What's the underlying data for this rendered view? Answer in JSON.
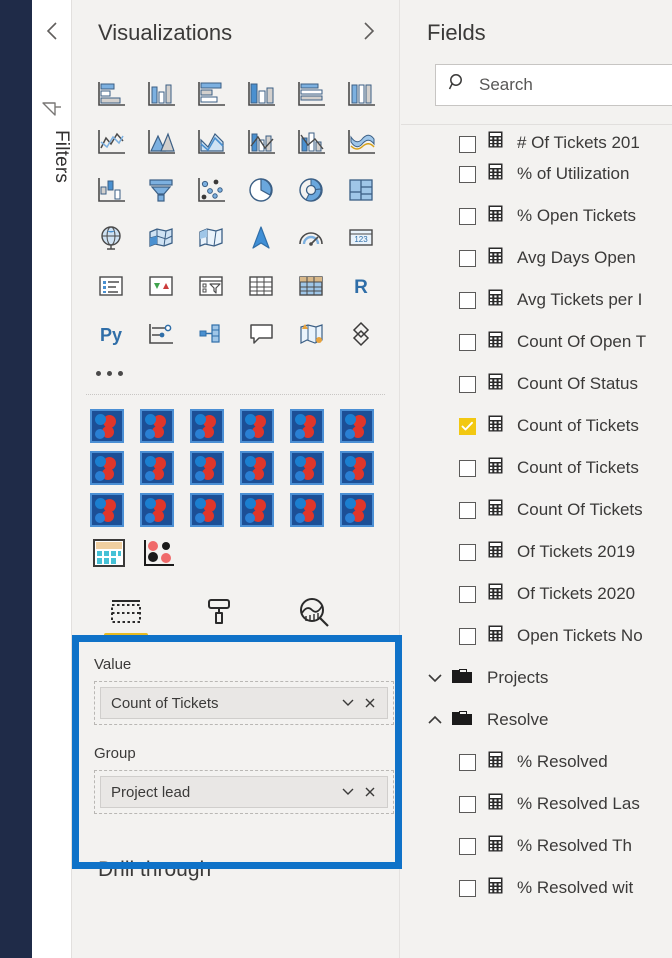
{
  "left_rail": {
    "name": "nav-rail"
  },
  "filters_pane": {
    "collapse_icon": "chevron-left-icon",
    "funnel_icon": "filter-funnel-icon",
    "label": "Filters"
  },
  "visualizations": {
    "title": "Visualizations",
    "expand_icon": "chevron-right-icon",
    "icons": [
      "stacked-bar-chart-icon",
      "stacked-column-chart-icon",
      "clustered-bar-chart-icon",
      "clustered-column-chart-icon",
      "hundred-percent-stacked-bar-chart-icon",
      "hundred-percent-stacked-column-chart-icon",
      "line-chart-icon",
      "area-chart-icon",
      "stacked-area-chart-icon",
      "line-and-stacked-column-chart-icon",
      "line-and-clustered-column-chart-icon",
      "ribbon-chart-icon",
      "waterfall-chart-icon",
      "funnel-chart-icon",
      "scatter-chart-icon",
      "pie-chart-icon",
      "donut-chart-icon",
      "treemap-icon",
      "map-icon",
      "filled-map-icon",
      "shape-map-icon",
      "azure-map-icon",
      "gauge-icon",
      "card-icon",
      "multi-row-card-icon",
      "kpi-icon",
      "slicer-icon",
      "table-icon",
      "matrix-icon",
      "r-script-visual-icon",
      "python-visual-icon",
      "key-influencers-icon",
      "decomposition-tree-icon",
      "qna-icon",
      "smart-narrative-icon",
      "paginated-report-icon"
    ],
    "more_icon": "more-options-ellipsis-icon",
    "custom_visuals_count": 18,
    "custom_visual_icon": "broken-image-placeholder-icon",
    "extra_visuals": [
      "custom-visual-matrix-icon",
      "custom-visual-dotplot-icon"
    ],
    "tabs": [
      {
        "icon": "fields-pane-icon",
        "label": "Fields",
        "active": true
      },
      {
        "icon": "format-paint-roller-icon",
        "label": "Format",
        "active": false
      },
      {
        "icon": "analytics-magnifier-icon",
        "label": "Analytics",
        "active": false
      }
    ],
    "wells": [
      {
        "label": "Value",
        "chip": "Count of Tickets",
        "dropdown_icon": "chevron-down-icon",
        "remove_icon": "close-x-icon"
      },
      {
        "label": "Group",
        "chip": "Project lead",
        "dropdown_icon": "chevron-down-icon",
        "remove_icon": "close-x-icon"
      }
    ],
    "drill_through_title": "Drill through",
    "highlight_color": "#0f72c8"
  },
  "fields": {
    "title": "Fields",
    "search": {
      "icon": "search-icon",
      "placeholder": "Search",
      "value": ""
    },
    "items": [
      {
        "type": "field",
        "name": "# Of Tickets 201",
        "checked": false,
        "icon": "measure-calculator-icon",
        "clipped": true
      },
      {
        "type": "field",
        "name": "% of Utilization",
        "checked": false,
        "icon": "measure-calculator-icon"
      },
      {
        "type": "field",
        "name": "% Open Tickets",
        "checked": false,
        "icon": "measure-calculator-icon"
      },
      {
        "type": "field",
        "name": "Avg Days Open",
        "checked": false,
        "icon": "measure-calculator-icon"
      },
      {
        "type": "field",
        "name": "Avg Tickets per I",
        "checked": false,
        "icon": "measure-calculator-icon"
      },
      {
        "type": "field",
        "name": "Count Of Open T",
        "checked": false,
        "icon": "measure-calculator-icon"
      },
      {
        "type": "field",
        "name": "Count Of Status",
        "checked": false,
        "icon": "measure-calculator-icon"
      },
      {
        "type": "field",
        "name": "Count of Tickets",
        "checked": true,
        "icon": "measure-calculator-icon"
      },
      {
        "type": "field",
        "name": "Count of Tickets",
        "checked": false,
        "icon": "measure-calculator-icon"
      },
      {
        "type": "field",
        "name": "Count Of Tickets",
        "checked": false,
        "icon": "measure-calculator-icon"
      },
      {
        "type": "field",
        "name": "Of Tickets 2019",
        "checked": false,
        "icon": "measure-calculator-icon"
      },
      {
        "type": "field",
        "name": "Of Tickets 2020",
        "checked": false,
        "icon": "measure-calculator-icon"
      },
      {
        "type": "field",
        "name": "Open Tickets No",
        "checked": false,
        "icon": "measure-calculator-icon"
      },
      {
        "type": "folder",
        "name": "Projects",
        "expanded": false,
        "chevron": "chevron-down-icon",
        "icon": "folder-icon"
      },
      {
        "type": "folder",
        "name": "Resolve",
        "expanded": true,
        "chevron": "chevron-up-icon",
        "icon": "folder-icon"
      },
      {
        "type": "field",
        "name": "% Resolved",
        "checked": false,
        "icon": "measure-calculator-icon",
        "indent": true
      },
      {
        "type": "field",
        "name": "% Resolved Las",
        "checked": false,
        "icon": "measure-calculator-icon",
        "indent": true
      },
      {
        "type": "field",
        "name": "% Resolved Th",
        "checked": false,
        "icon": "measure-calculator-icon",
        "indent": true
      },
      {
        "type": "field",
        "name": "% Resolved wit",
        "checked": false,
        "icon": "measure-calculator-icon",
        "indent": true
      }
    ]
  }
}
